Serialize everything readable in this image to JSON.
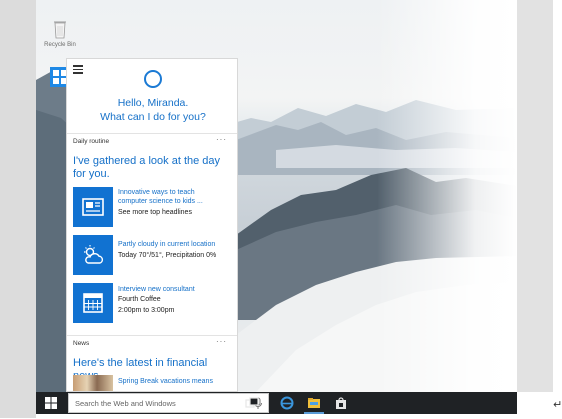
{
  "desktop": {
    "icons": [
      {
        "name": "recycle-bin-icon",
        "label": "Recycle Bin"
      },
      {
        "name": "windows-app-icon",
        "label": ""
      }
    ]
  },
  "cortana": {
    "greeting_line1": "Hello, Miranda.",
    "greeting_line2": "What can I do for you?",
    "sections": {
      "daily": {
        "label": "Daily routine",
        "more": "···",
        "headline": "I've gathered a look at the day for you.",
        "cards": [
          {
            "icon": "news-icon",
            "line1": "Innovative ways to teach",
            "line2": "computer science to kids ...",
            "line3": "See more top headlines"
          },
          {
            "icon": "weather-icon",
            "line1": "Partly cloudy in current location",
            "line2": "Today 70°/51°, Precipitation 0%"
          },
          {
            "icon": "calendar-icon",
            "line1": "Interview new consultant",
            "line2": "Fourth Coffee",
            "line3": "2:00pm to 3:00pm"
          }
        ]
      },
      "news": {
        "label": "News",
        "more": "···",
        "headline": "Here's the latest in financial news.",
        "items": [
          {
            "title": "Spring Break vacations means"
          }
        ]
      }
    }
  },
  "taskbar": {
    "search_placeholder": "Search the Web and Windows",
    "icons": [
      "windows-start-icon",
      "microphone-icon",
      "task-view-icon",
      "edge-browser-icon",
      "file-explorer-icon",
      "store-icon"
    ]
  },
  "page": {
    "return_mark": "↵"
  },
  "colors": {
    "accent": "#1172d1",
    "link_text": "#1570c8",
    "taskbar": "#1f2225"
  }
}
